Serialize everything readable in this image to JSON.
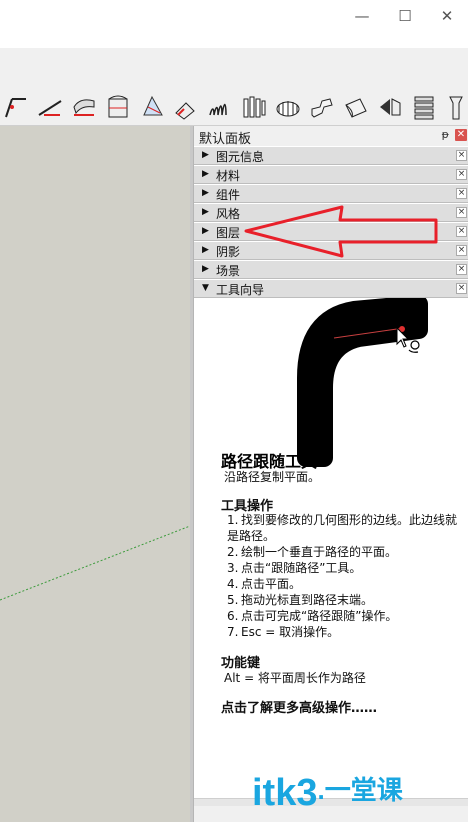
{
  "window": {
    "minimize_symbol": "—",
    "maximize_symbol": "☐",
    "close_symbol": "✕"
  },
  "toolbar": {
    "tools": [
      {
        "icon": "line-tool-icon"
      },
      {
        "icon": "arc-tool-icon"
      },
      {
        "icon": "followme-tool-icon"
      },
      {
        "icon": "cabinet-tool-icon"
      },
      {
        "icon": "section-tool-icon"
      },
      {
        "icon": "paint-tool-icon"
      },
      {
        "icon": "spring-tool-icon"
      },
      {
        "icon": "coil-tool-icon"
      },
      {
        "icon": "ring-tool-icon"
      },
      {
        "icon": "bend-tool-icon"
      },
      {
        "icon": "surface-tool-icon"
      },
      {
        "icon": "flip-tool-icon"
      },
      {
        "icon": "stack-tool-icon"
      },
      {
        "icon": "pin-tool-icon"
      }
    ]
  },
  "panel": {
    "title": "默认面板",
    "pin_symbol": "ᵽ",
    "close_symbol": "✕",
    "trays": [
      {
        "label": "图元信息",
        "expanded": false
      },
      {
        "label": "材料",
        "expanded": false
      },
      {
        "label": "组件",
        "expanded": false
      },
      {
        "label": "风格",
        "expanded": false
      },
      {
        "label": "图层",
        "expanded": false
      },
      {
        "label": "阴影",
        "expanded": false
      },
      {
        "label": "场景",
        "expanded": false
      },
      {
        "label": "工具向导",
        "expanded": true
      }
    ],
    "tray_close_symbol": "×",
    "collapsed_arrow": "▶",
    "expanded_arrow": "▼"
  },
  "guide": {
    "title": "路径跟随工具",
    "subtitle": "沿路径复制平面。",
    "operations_heading": "工具操作",
    "steps": [
      {
        "n": "1.",
        "text": "找到要修改的几何图形的边线。此边线就是路径。"
      },
      {
        "n": "2.",
        "text": "绘制一个垂直于路径的平面。"
      },
      {
        "n": "3.",
        "text": "点击“跟随路径”工具。"
      },
      {
        "n": "4.",
        "text": "点击平面。"
      },
      {
        "n": "5.",
        "text": "拖动光标直到路径末端。"
      },
      {
        "n": "6.",
        "text": "点击可完成“路径跟随”操作。"
      },
      {
        "n": "7.",
        "text": "Esc = 取消操作。"
      }
    ],
    "keys_heading": "功能键",
    "keys_text": "Alt = 将平面周长作为路径",
    "more_link": "点击了解更多高级操作……"
  },
  "watermark": {
    "text": "itk3",
    "suffix": ".一堂课"
  },
  "colors": {
    "canvas": "#d1d0c8",
    "annotation_arrow": "#e8202a",
    "watermark": "#1aa6e0"
  }
}
